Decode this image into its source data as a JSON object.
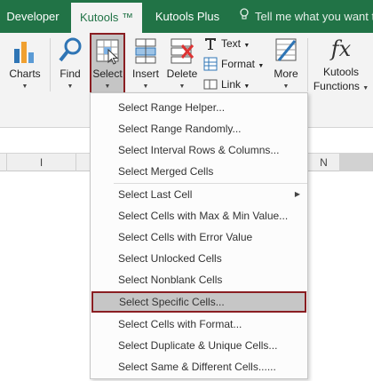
{
  "tabs": {
    "developer": "Developer",
    "kutools": "Kutools ™",
    "kutools_plus": "Kutools Plus",
    "tell_me": "Tell me what you want to"
  },
  "ribbon": {
    "charts": "Charts",
    "find": "Find",
    "select": "Select",
    "insert": "Insert",
    "delete": "Delete",
    "text": "Text",
    "format": "Format",
    "link": "Link",
    "more": "More",
    "kutools_functions_line1": "Kutools",
    "kutools_functions_line2": "Functions",
    "fx_glyph": "fx",
    "caret": "▼"
  },
  "columns": {
    "i": "I",
    "n": "N"
  },
  "menu": {
    "items": [
      {
        "label": "Select Range Helper..."
      },
      {
        "label": "Select Range Randomly..."
      },
      {
        "label": "Select Interval Rows & Columns..."
      },
      {
        "label": "Select Merged Cells"
      },
      {
        "label": "Select Last Cell"
      },
      {
        "label": "Select Cells with Max & Min Value..."
      },
      {
        "label": "Select Cells with Error Value"
      },
      {
        "label": "Select Unlocked Cells"
      },
      {
        "label": "Select Nonblank Cells"
      },
      {
        "label": "Select Specific Cells..."
      },
      {
        "label": "Select Cells with Format..."
      },
      {
        "label": "Select Duplicate & Unique Cells..."
      },
      {
        "label": "Select Same & Different Cells......"
      }
    ],
    "submenu_arrow": "▶"
  },
  "colors": {
    "title_green": "#217346",
    "highlight_border": "#8a1e22"
  }
}
